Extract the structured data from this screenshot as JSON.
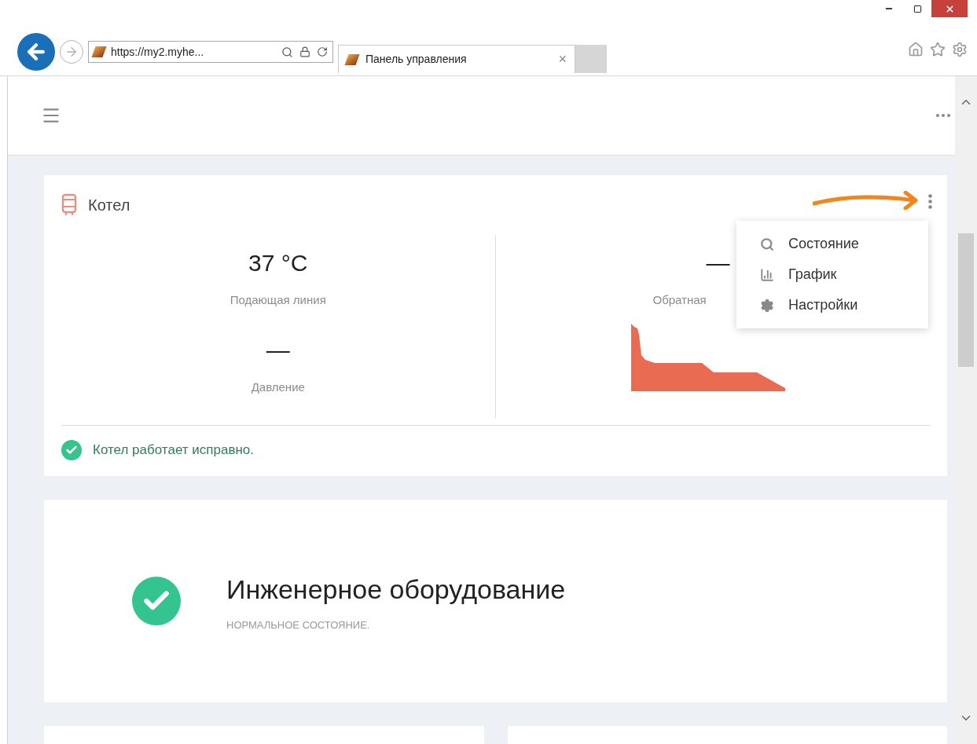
{
  "browser": {
    "address": "https://my2.myhe...",
    "tab_title": "Панель управления",
    "tab_close": "×"
  },
  "card": {
    "title": "Котел",
    "metrics": [
      {
        "value": "37 °C",
        "label": "Подающая линия"
      },
      {
        "value": "—",
        "label": "Обратная"
      },
      {
        "value": "—",
        "label": "Давление"
      }
    ],
    "status": "Котел работает исправно."
  },
  "menu": {
    "items": [
      {
        "kind": "search",
        "label": "Состояние"
      },
      {
        "kind": "chart",
        "label": "График"
      },
      {
        "kind": "settings",
        "label": "Настройки"
      }
    ]
  },
  "summary": {
    "title": "Инженерное оборудование",
    "subtitle": "НОРМАЛЬНОЕ СОСТОЯНИЕ."
  }
}
